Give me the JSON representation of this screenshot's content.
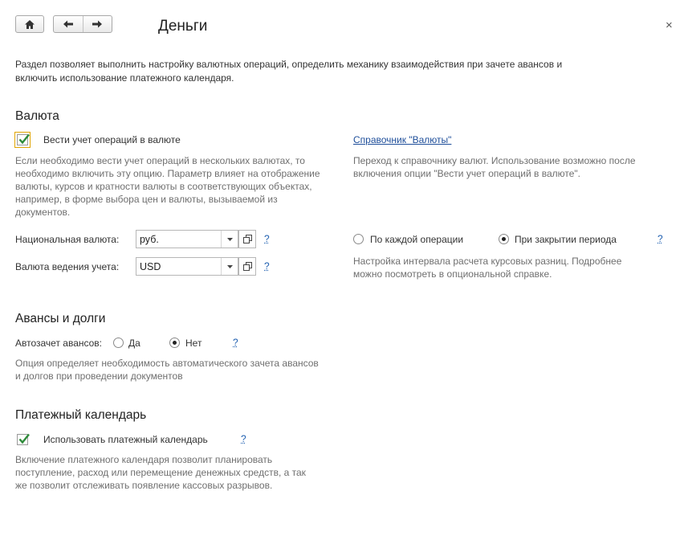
{
  "window": {
    "title": "Деньги",
    "close_label": "×"
  },
  "intro": "Раздел позволяет выполнить настройку валютных операций,  определить механику взаимодействия при зачете авансов и включить использование платежного календаря.",
  "currency": {
    "heading": "Валюта",
    "multi_currency_label": "Вести учет операций в валюте",
    "multi_currency_checked": true,
    "multi_currency_hint_lines": [
      "Если необходимо вести учет операций в нескольких валютах, то",
      "необходимо включить эту опцию. Параметр влияет на отображение",
      "валюты, курсов и кратности валюты в соответствующих объектах,",
      "например, в форме выбора цен и валюты, вызываемой из",
      "документов."
    ],
    "catalog_link": "Справочник \"Валюты\"",
    "catalog_hint_lines": [
      "Переход к справочнику валют. Использование возможно после",
      "включения опции \"Вести учет операций в валюте\"."
    ],
    "national_label": "Национальная валюта:",
    "national_value": "руб.",
    "accounting_label": "Валюта ведения учета:",
    "accounting_value": "USD",
    "help_mark": "?",
    "rate_options": [
      "По каждой операции",
      "При закрытии периода"
    ],
    "rate_selected": 1,
    "rate_hint_lines": [
      "Настройка интервала расчета курсовых разниц. Подробнее",
      "можно посмотреть в опциональной справке."
    ]
  },
  "advances": {
    "heading": "Авансы и долги",
    "autooffset_label": "Автозачет авансов:",
    "options": [
      "Да",
      "Нет"
    ],
    "selected": 1,
    "hint_lines": [
      "Опция определяет необходимость автоматического зачета авансов",
      "и долгов при проведении документов"
    ]
  },
  "calendar": {
    "heading": "Платежный календарь",
    "use_label": "Использовать платежный календарь",
    "use_checked": true,
    "hint_lines": [
      "Включение платежного календаря позволит планировать",
      "поступление, расход или перемещение денежных средств, а так",
      "же позволит отслеживать появление кассовых разрывов."
    ]
  },
  "colors": {
    "check_green": "#2e8b3a",
    "link_blue": "#1e4e9a",
    "hint_gray": "#6f6f6f",
    "focus_outline": "#e0a400"
  },
  "icons": {
    "home": "home-icon",
    "back": "arrow-left-icon",
    "forward": "arrow-right-icon",
    "dropdown": "triangle-down-icon",
    "open": "open-window-icon",
    "check": "checkmark-icon"
  }
}
